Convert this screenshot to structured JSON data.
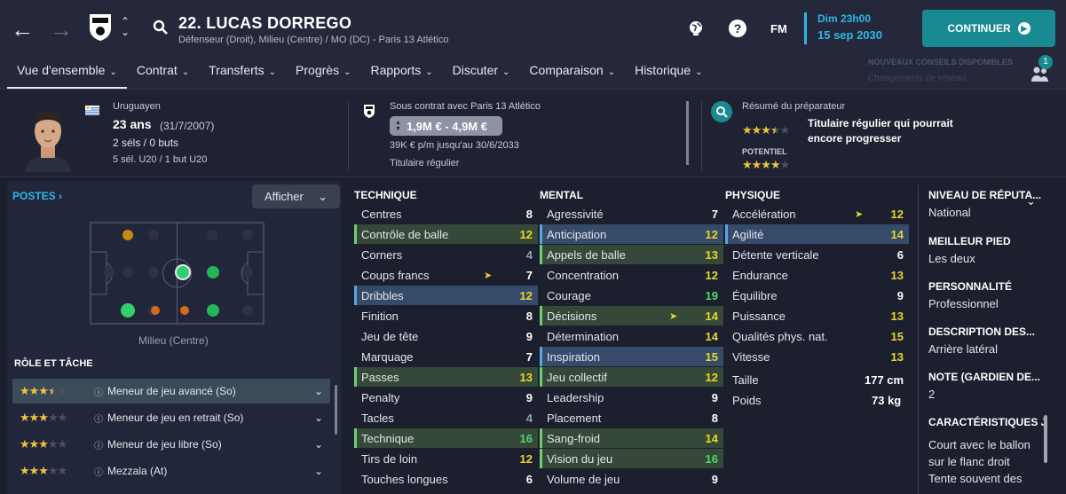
{
  "header": {
    "player_title": "22. LUCAS DORREGO",
    "subtitle": "Défenseur (Droit), Milieu (Centre) / MO (DC) - Paris 13 Atlético",
    "date_day": "Dim 23h00",
    "date_full": "15 sep 2030",
    "continue_label": "CONTINUER",
    "fm_label": "FM",
    "notif_count": "1",
    "notif_text": "NOUVEAUX CONSEILS DISPONIBLES",
    "notif_sub": "Changements de réseau"
  },
  "tabs": [
    {
      "label": "Vue d'ensemble"
    },
    {
      "label": "Contrat"
    },
    {
      "label": "Transferts"
    },
    {
      "label": "Progrès"
    },
    {
      "label": "Rapports"
    },
    {
      "label": "Discuter"
    },
    {
      "label": "Comparaison"
    },
    {
      "label": "Historique"
    }
  ],
  "profile": {
    "nationality": "Uruguayen",
    "age": "23 ans",
    "dob": "(31/7/2007)",
    "caps": "2 séls / 0 buts",
    "youth_caps": "5 sél. U20 / 1 but U20"
  },
  "contract": {
    "status": "Sous contrat avec Paris 13 Atlético",
    "value": "1,9M € - 4,9M €",
    "wage": "39K € p/m jusqu'au 30/6/2033",
    "role": "Titulaire régulier"
  },
  "coach": {
    "heading": "Résumé du préparateur",
    "summary": "Titulaire régulier qui pourrait encore progresser",
    "potential_label": "POTENTIEL",
    "current_stars": 3.5,
    "potential_stars": 4
  },
  "positions": {
    "label": "POSTES",
    "show_label": "Afficher",
    "position_name": "Milieu (Centre)"
  },
  "roles": {
    "heading": "RÔLE ET TÂCHE",
    "items": [
      {
        "stars": 3.5,
        "name": "Meneur de jeu avancé (So)"
      },
      {
        "stars": 3,
        "name": "Meneur de jeu en retrait (So)"
      },
      {
        "stars": 3,
        "name": "Meneur de jeu libre (So)"
      },
      {
        "stars": 3,
        "name": "Mezzala (At)"
      }
    ]
  },
  "technique": {
    "heading": "TECHNIQUE",
    "rows": [
      {
        "n": "Centres",
        "v": "8"
      },
      {
        "n": "Contrôle de balle",
        "v": "12"
      },
      {
        "n": "Corners",
        "v": "4"
      },
      {
        "n": "Coups francs",
        "v": "7"
      },
      {
        "n": "Dribbles",
        "v": "12"
      },
      {
        "n": "Finition",
        "v": "8"
      },
      {
        "n": "Jeu de tête",
        "v": "9"
      },
      {
        "n": "Marquage",
        "v": "7"
      },
      {
        "n": "Passes",
        "v": "13"
      },
      {
        "n": "Penalty",
        "v": "9"
      },
      {
        "n": "Tacles",
        "v": "4"
      },
      {
        "n": "Technique",
        "v": "16"
      },
      {
        "n": "Tirs de loin",
        "v": "12"
      },
      {
        "n": "Touches longues",
        "v": "6"
      }
    ]
  },
  "mental": {
    "heading": "MENTAL",
    "rows": [
      {
        "n": "Agressivité",
        "v": "7"
      },
      {
        "n": "Anticipation",
        "v": "12"
      },
      {
        "n": "Appels de balle",
        "v": "13"
      },
      {
        "n": "Concentration",
        "v": "12"
      },
      {
        "n": "Courage",
        "v": "19"
      },
      {
        "n": "Décisions",
        "v": "14"
      },
      {
        "n": "Détermination",
        "v": "14"
      },
      {
        "n": "Inspiration",
        "v": "15"
      },
      {
        "n": "Jeu collectif",
        "v": "12"
      },
      {
        "n": "Leadership",
        "v": "9"
      },
      {
        "n": "Placement",
        "v": "8"
      },
      {
        "n": "Sang-froid",
        "v": "14"
      },
      {
        "n": "Vision du jeu",
        "v": "16"
      },
      {
        "n": "Volume de jeu",
        "v": "9"
      }
    ]
  },
  "physique": {
    "heading": "PHYSIQUE",
    "rows": [
      {
        "n": "Accélération",
        "v": "12"
      },
      {
        "n": "Agilité",
        "v": "14"
      },
      {
        "n": "Détente verticale",
        "v": "6"
      },
      {
        "n": "Endurance",
        "v": "13"
      },
      {
        "n": "Équilibre",
        "v": "9"
      },
      {
        "n": "Puissance",
        "v": "13"
      },
      {
        "n": "Qualités phys. nat.",
        "v": "15"
      },
      {
        "n": "Vitesse",
        "v": "13"
      }
    ],
    "height_label": "Taille",
    "height": "177 cm",
    "weight_label": "Poids",
    "weight": "73 kg"
  },
  "info": [
    {
      "h": "NIVEAU DE RÉPUTA...",
      "v": "National"
    },
    {
      "h": "MEILLEUR PIED",
      "v": "Les deux"
    },
    {
      "h": "PERSONNALITÉ",
      "v": "Professionnel"
    },
    {
      "h": "DESCRIPTION DES...",
      "v": "Arrière latéral"
    },
    {
      "h": "NOTE (GARDIEN DE...",
      "v": "2"
    },
    {
      "h": "CARACTÉRISTIQUES JO",
      "v": "Court avec le ballon sur le flanc droit",
      "v2": "Tente souvent des"
    }
  ]
}
